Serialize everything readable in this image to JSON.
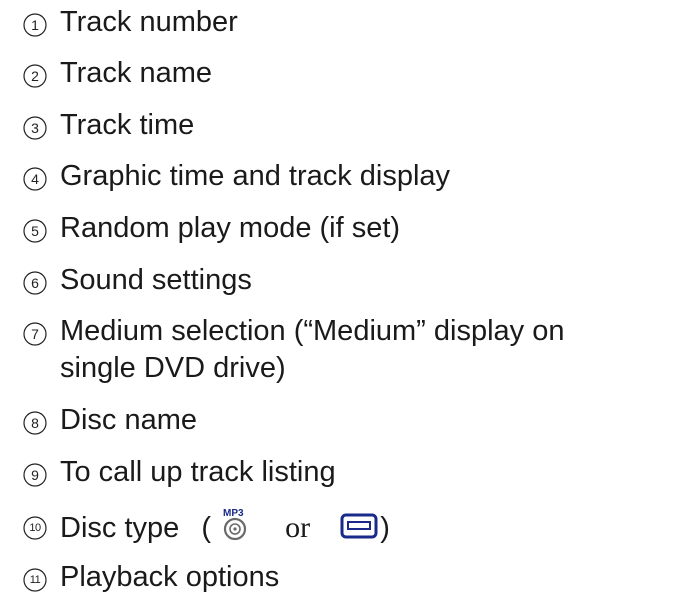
{
  "legend": {
    "items": [
      {
        "number": "1",
        "label": "Track number"
      },
      {
        "number": "2",
        "label": "Track name"
      },
      {
        "number": "3",
        "label": "Track time"
      },
      {
        "number": "4",
        "label": "Graphic time and track display"
      },
      {
        "number": "5",
        "label": "Random play mode (if set)"
      },
      {
        "number": "6",
        "label": "Sound settings"
      },
      {
        "number": "7",
        "label": "Medium selection (“Medium” display on",
        "label_line2": "single DVD drive)"
      },
      {
        "number": "8",
        "label": "Disc name"
      },
      {
        "number": "9",
        "label": "To call up track listing"
      },
      {
        "number": "10",
        "label": "Disc type",
        "paren_open": "(",
        "or": "or",
        "paren_close": ")",
        "mp3_icon_text": "MP3",
        "icons": [
          "mp3-disc-icon",
          "disc-slot-icon"
        ]
      },
      {
        "number": "11",
        "label": "Playback options"
      }
    ]
  }
}
